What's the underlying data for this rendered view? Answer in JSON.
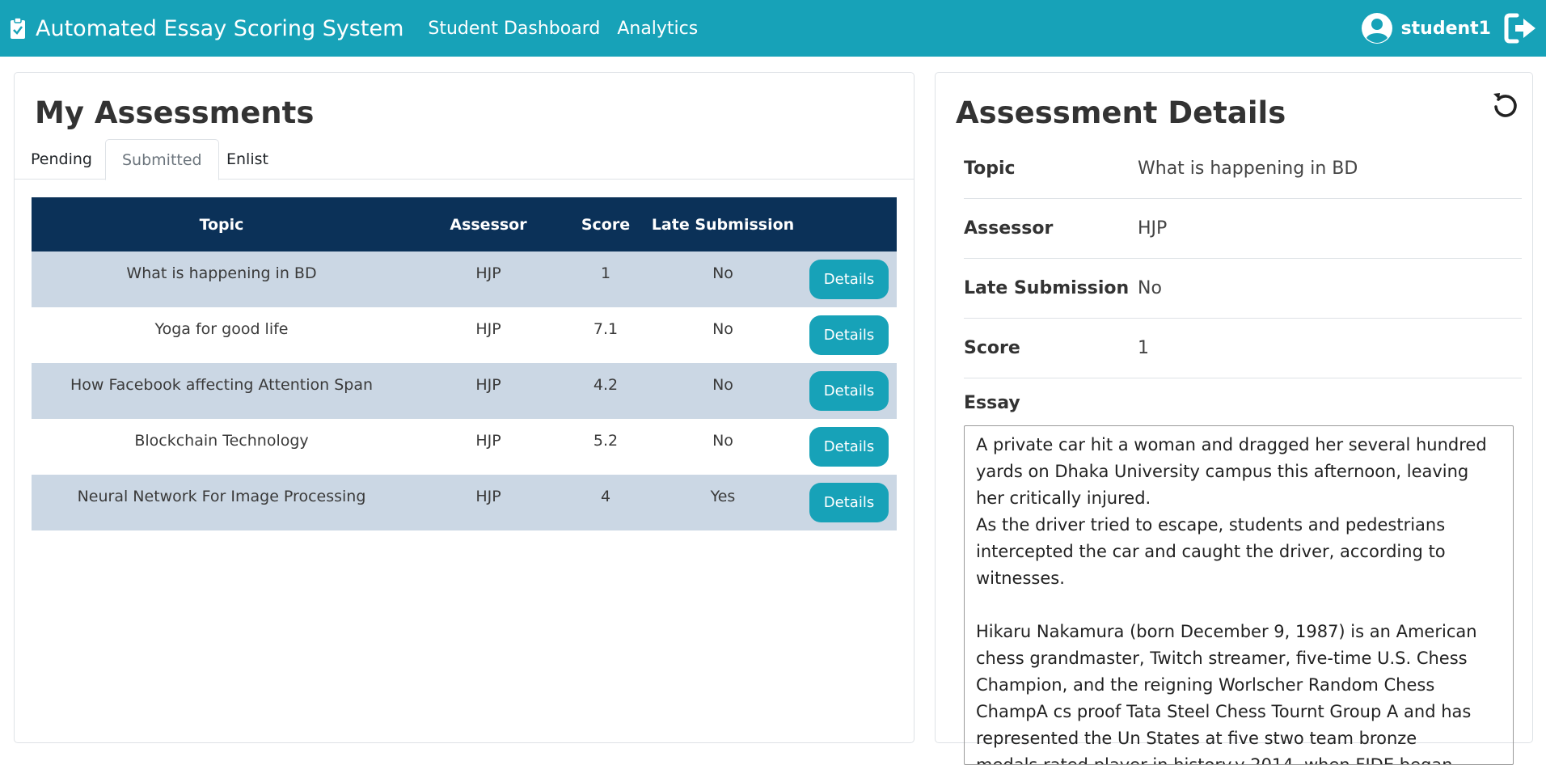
{
  "navbar": {
    "brand_icon": "clipboard-check-icon",
    "brand": "Automated Essay Scoring System",
    "links": [
      "Student Dashboard",
      "Analytics"
    ],
    "user_icon": "user-circle-icon",
    "username": "student1",
    "logout_icon": "sign-out-icon",
    "color": "#17a2b8"
  },
  "assessments": {
    "title": "My Assessments",
    "tabs": [
      "Pending",
      "Submitted",
      "Enlist"
    ],
    "active_tab": "Submitted",
    "columns": [
      "Topic",
      "Assessor",
      "Score",
      "Late Submission",
      ""
    ],
    "rows": [
      {
        "topic": "What is happening in BD",
        "assessor": "HJP",
        "score": "1",
        "late": "No",
        "action": "Details"
      },
      {
        "topic": "Yoga for good life",
        "assessor": "HJP",
        "score": "7.1",
        "late": "No",
        "action": "Details"
      },
      {
        "topic": "How Facebook affecting Attention Span",
        "assessor": "HJP",
        "score": "4.2",
        "late": "No",
        "action": "Details"
      },
      {
        "topic": "Blockchain Technology",
        "assessor": "HJP",
        "score": "5.2",
        "late": "No",
        "action": "Details"
      },
      {
        "topic": "Neural Network For Image Processing",
        "assessor": "HJP",
        "score": "4",
        "late": "Yes",
        "action": "Details"
      }
    ],
    "header_color": "#0b3158",
    "stripe_color": "#cbd7e4"
  },
  "details": {
    "title": "Assessment Details",
    "refresh_icon": "refresh-icon",
    "fields": [
      {
        "label": "Topic",
        "value": "What is happening in BD"
      },
      {
        "label": "Assessor",
        "value": "HJP"
      },
      {
        "label": "Late Submission",
        "value": "No"
      },
      {
        "label": "Score",
        "value": "1"
      }
    ],
    "essay_label": "Essay",
    "essay": "A private car hit a woman and dragged her several hundred yards on Dhaka University campus this afternoon, leaving her critically injured.\nAs the driver tried to escape, students and pedestrians intercepted the car and caught the driver, according to witnesses.\n\nHikaru Nakamura (born December 9, 1987) is an American chess grandmaster, Twitch streamer, five-time U.S. Chess Champion, and the reigning Worlscher Random Chess ChampA cs proof Tata Steel Chess Tournt Group A and has represented the Un States at five stwo team bronze medals.rated player in history.y 2014, when FIDE began publishing official rapid and blitz ratings, Nakamura was"
  }
}
